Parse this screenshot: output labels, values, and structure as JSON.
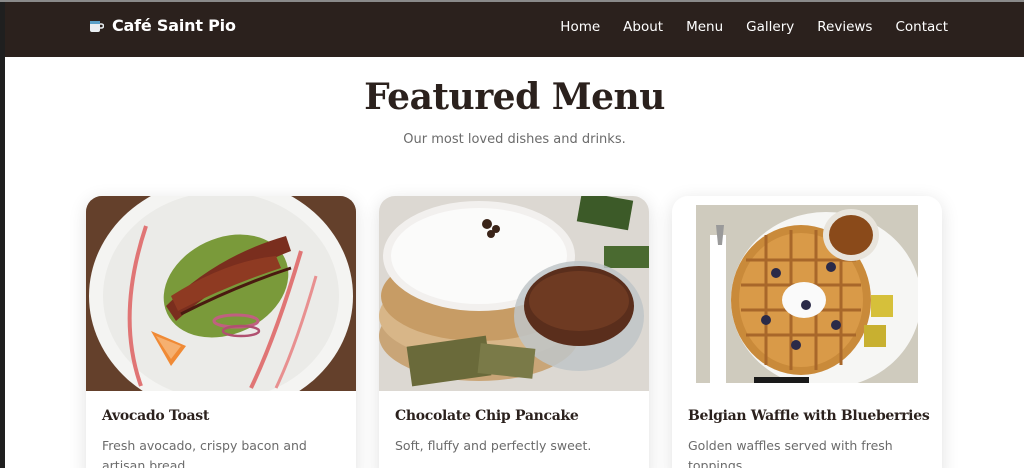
{
  "header": {
    "brand": "Café Saint Pio",
    "brand_icon": "coffee-cup-icon",
    "nav": [
      "Home",
      "About",
      "Menu",
      "Gallery",
      "Reviews",
      "Contact"
    ]
  },
  "main": {
    "title": "Featured Menu",
    "subtitle": "Our most loved dishes and drinks."
  },
  "cards": [
    {
      "name": "Avocado Toast",
      "description": "Fresh avocado, crispy bacon and artisan bread."
    },
    {
      "name": "Chocolate Chip Pancake",
      "description": "Soft, fluffy and perfectly sweet."
    },
    {
      "name": "Belgian Waffle with Blueberries",
      "description": "Golden waffles served with fresh toppings."
    }
  ],
  "colors": {
    "header_bg": "#2b211d",
    "title": "#2b211d",
    "muted_text": "#6b6b6b"
  }
}
